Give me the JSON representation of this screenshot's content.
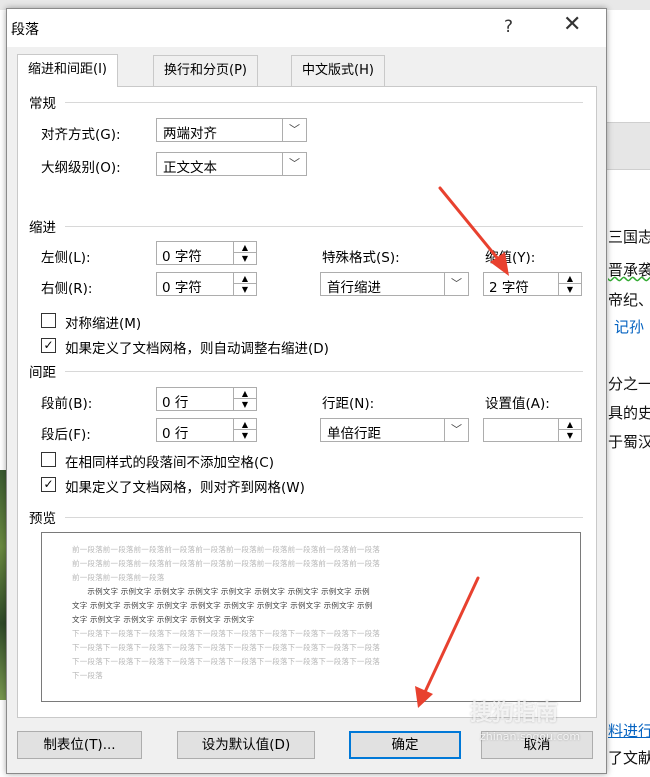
{
  "background": {
    "lines": [
      "三国志",
      "晋承袭",
      "帝纪、",
      "记孙",
      "分之一",
      "具的史",
      "于蜀汉",
      "料进行",
      "了文献"
    ]
  },
  "dialog": {
    "title": "段落",
    "help": "?",
    "close": "✕",
    "tabs": [
      "缩进和间距(I)",
      "换行和分页(P)",
      "中文版式(H)"
    ],
    "general": {
      "section": "常规",
      "align_label": "对齐方式(G):",
      "align_value": "两端对齐",
      "outline_label": "大纲级别(O):",
      "outline_value": "正文文本"
    },
    "indent": {
      "section": "缩进",
      "left_label": "左侧(L):",
      "left_value": "0 字符",
      "right_label": "右侧(R):",
      "right_value": "0 字符",
      "special_label": "特殊格式(S):",
      "special_value": "首行缩进",
      "by_label": "缩值(Y):",
      "by_value": "2 字符",
      "mirror_label": "对称缩进(M)",
      "mirror_checked": false,
      "auto_label": "如果定义了文档网格，则自动调整右缩进(D)",
      "auto_checked": true
    },
    "spacing": {
      "section": "间距",
      "before_label": "段前(B):",
      "before_value": "0 行",
      "after_label": "段后(F):",
      "after_value": "0 行",
      "line_label": "行距(N):",
      "line_value": "单倍行距",
      "at_label": "设置值(A):",
      "at_value": "",
      "noadd_label": "在相同样式的段落间不添加空格(C)",
      "noadd_checked": false,
      "snap_label": "如果定义了文档网格，则对齐到网格(W)",
      "snap_checked": true
    },
    "preview": {
      "section": "预览",
      "prev": [
        "前一段落前一段落前一段落前一段落前一段落前一段落前一段落前一段落前一段落前一段落",
        "前一段落前一段落前一段落前一段落前一段落前一段落前一段落前一段落前一段落前一段落",
        "前一段落前一段落前一段落"
      ],
      "sample": [
        "　　示例文字 示例文字 示例文字 示例文字 示例文字 示例文字 示例文字 示例文字 示例",
        "文字 示例文字 示例文字 示例文字 示例文字 示例文字 示例文字 示例文字 示例文字 示例",
        "文字 示例文字 示例文字 示例文字 示例文字 示例文字"
      ],
      "next": [
        "下一段落下一段落下一段落下一段落下一段落下一段落下一段落下一段落下一段落下一段落",
        "下一段落下一段落下一段落下一段落下一段落下一段落下一段落下一段落下一段落下一段落",
        "下一段落下一段落下一段落下一段落下一段落下一段落下一段落下一段落下一段落下一段落",
        "下一段落"
      ]
    },
    "buttons": {
      "tabs": "制表位(T)...",
      "default": "设为默认值(D)",
      "ok": "确定",
      "cancel": "取消"
    }
  },
  "watermark": {
    "text": "搜狗指南",
    "url": "zhinan.sogou.com"
  },
  "colors": {
    "arrow": "#e8412f",
    "accent": "#0078d7"
  }
}
